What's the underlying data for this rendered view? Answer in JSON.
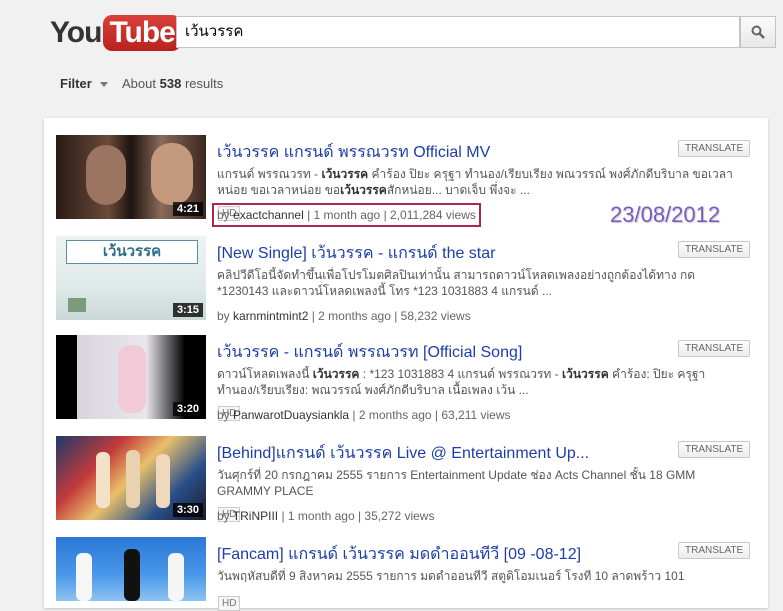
{
  "logo": {
    "you": "You",
    "tube": "Tube"
  },
  "search": {
    "value": "เว้นวรรค"
  },
  "filter": {
    "label": "Filter",
    "about": "About",
    "count": "538",
    "suffix": "results"
  },
  "translate_label": "TRANSLATE",
  "hd_label": "HD",
  "date_stamp": "23/08/2012",
  "results": [
    {
      "title": "เว้นวรรค แกรนด์ พรรณวรท Official MV",
      "desc_a": "แกรนด์ พรรณวรท - ",
      "desc_b": "เว้นวรรค",
      "desc_c": " คำร้อง ปิยะ ครุฐา ทำนอง/เรียบเรียง พณวรรณ์ พงศ์ภักดีบริบาล ขอเวลาหน่อย ขอเวลาหน่อย ขอ",
      "desc_d": "เว้นวรรค",
      "desc_e": "สักหน่อย... บาดเจ็บ พึ่งจะ ...",
      "meta_by": "by ",
      "user": "exactchannel",
      "meta_rest": " | 1 month ago | 2,011,284 views",
      "duration": "4:21",
      "hd": true,
      "boxed": true
    },
    {
      "title": "[New Single] เว้นวรรค - แกรนด์ the star",
      "desc_a": "คลิปวีดีโอนี้จัดทำขึ้นเพื่อโปรโมตศิลปินเท่านั้น สามารถดาวน์โหลดเพลงอย่างถูกต้องได้ทาง กด *1230143 และดาวน์โหลดเพลงนี้ โทร *123 1031883 4 แกรนด์ ...",
      "desc_b": "",
      "desc_c": "",
      "desc_d": "",
      "desc_e": "",
      "meta_by": "by ",
      "user": "karnmintmint2",
      "meta_rest": " | 2 months ago | 58,232 views",
      "duration": "3:15",
      "hd": false,
      "boxed": false
    },
    {
      "title": "เว้นวรรค - แกรนด์ พรรณวรท [Official Song]",
      "desc_a": "ดาวน์โหลดเพลงนี้ ",
      "desc_b": "เว้นวรรค",
      "desc_c": " : *123 1031883 4 แกรนด์ พรรณวรท - ",
      "desc_d": "เว้นวรรค",
      "desc_e": " คำร้อง: ปิยะ ครุฐา ทำนอง/เรียบเรียง: พณวรรณ์ พงศ์ภักดีบริบาล เนื้อเพลง เว้น ...",
      "meta_by": "by ",
      "user": "PanwarotDuaysiankla",
      "meta_rest": " | 2 months ago | 63,211 views",
      "duration": "3:20",
      "hd": true,
      "boxed": false
    },
    {
      "title": "[Behind]แกรนด์ เว้นวรรค Live @ Entertainment Up...",
      "desc_a": "วันศุกร์ที่ 20 กรกฎาคม 2555 รายการ Entertainment Update ช่อง Acts Channel ชั้น 18 GMM GRAMMY PLACE",
      "desc_b": "",
      "desc_c": "",
      "desc_d": "",
      "desc_e": "",
      "meta_by": "by ",
      "user": "TRiNPIII",
      "meta_rest": " | 1 month ago | 35,272 views",
      "duration": "3:30",
      "hd": true,
      "boxed": false
    },
    {
      "title": "[Fancam] แกรนด์ เว้นวรรค มดดำออนทีวี [09 -08-12]",
      "desc_a": "วันพฤหัสบดีที่ 9 สิงหาคม 2555 รายการ มดดำออนทีวี สตูดิโอมเนอร์ โรงที 10 ลาดพร้าว 101",
      "desc_b": "",
      "desc_c": "",
      "desc_d": "",
      "desc_e": "",
      "meta_by": "",
      "user": "",
      "meta_rest": "",
      "duration": "",
      "hd": true,
      "boxed": false
    }
  ]
}
